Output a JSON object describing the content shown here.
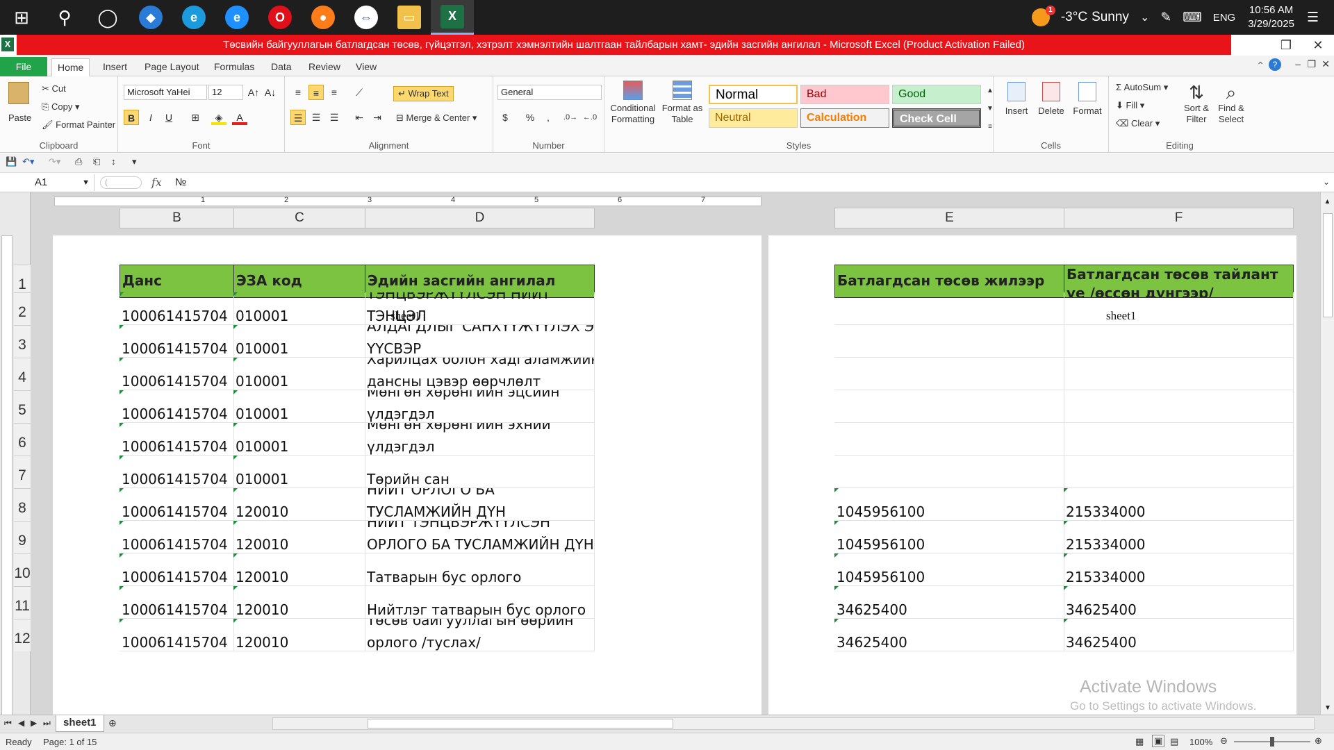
{
  "taskbar": {
    "weather_temp": "-3°C",
    "weather_desc": "Sunny",
    "weather_badge": "1",
    "language": "ENG",
    "time": "10:56 AM",
    "date": "3/29/2025"
  },
  "window": {
    "title": "Төсвийн байгууллагын батлагдсан төсөв, гүйцэтгэл, хэтрэлт хэмнэлтийн шалтгаан тайлбарын хамт- эдийн засгийн ангилал  -  Microsoft Excel (Product Activation Failed)"
  },
  "tabs": [
    "File",
    "Home",
    "Insert",
    "Page Layout",
    "Formulas",
    "Data",
    "Review",
    "View"
  ],
  "ribbon": {
    "clipboard": {
      "paste": "Paste",
      "cut": "Cut",
      "copy": "Copy",
      "format_painter": "Format Painter",
      "label": "Clipboard"
    },
    "font": {
      "name": "Microsoft YaHei",
      "size": "12",
      "label": "Font",
      "bold": "B",
      "italic": "I",
      "underline": "U"
    },
    "alignment": {
      "wrap_text": "Wrap Text",
      "merge_center": "Merge & Center",
      "label": "Alignment"
    },
    "number": {
      "format": "General",
      "currency": "$",
      "percent": "%",
      "comma": ",",
      "label": "Number"
    },
    "styles": {
      "conditional_formatting": "Conditional Formatting",
      "format_as_table": "Format as Table",
      "normal": "Normal",
      "bad": "Bad",
      "good": "Good",
      "neutral": "Neutral",
      "calculation": "Calculation",
      "check_cell": "Check Cell",
      "label": "Styles"
    },
    "cells": {
      "insert": "Insert",
      "delete": "Delete",
      "format": "Format",
      "label": "Cells"
    },
    "editing": {
      "autosum": "AutoSum",
      "fill": "Fill",
      "clear": "Clear",
      "sort_filter": "Sort & Filter",
      "find_select": "Find & Select",
      "label": "Editing"
    }
  },
  "formula_bar": {
    "name_box": "A1",
    "fx": "fx",
    "content": "№"
  },
  "ruler_marks": [
    "1",
    "2",
    "3",
    "4",
    "5",
    "6",
    "7"
  ],
  "sheet": {
    "page_title": "sheet1",
    "columns_left": [
      "B",
      "C",
      "D"
    ],
    "columns_right": [
      "E",
      "F"
    ],
    "row_numbers": [
      "1",
      "2",
      "3",
      "4",
      "5",
      "6",
      "7",
      "8",
      "9",
      "10",
      "11",
      "12"
    ],
    "headers": {
      "B": "Данс",
      "C": "ЭЗА код",
      "D": "Эдийн засгийн ангилал",
      "E": "Батлагдсан төсөв жилээр",
      "F": "Батлагдсан төсөв тайлант үе /өссөн дүнгээр/"
    },
    "rows": [
      {
        "b": "100061415704",
        "c": "010001",
        "d1": "ТЭНЦВЭРЖҮҮЛСЭН НИЙТ",
        "d2": "ТЭНЦЭЛ",
        "e": "",
        "f": ""
      },
      {
        "b": "100061415704",
        "c": "010001",
        "d1": "АЛДАГДЛЫГ САНХҮҮЖҮҮЛЭХ ЭХ",
        "d2": "ҮҮСВЭР",
        "e": "",
        "f": ""
      },
      {
        "b": "100061415704",
        "c": "010001",
        "d1": "Харилцах болон хадгаламжийн",
        "d2": "дансны цэвэр өөрчлөлт",
        "e": "",
        "f": ""
      },
      {
        "b": "100061415704",
        "c": "010001",
        "d1": "Мөнгөн хөрөнгийн эцсийн",
        "d2": "үлдэгдэл",
        "e": "",
        "f": ""
      },
      {
        "b": "100061415704",
        "c": "010001",
        "d1": "Мөнгөн хөрөнгийн эхний",
        "d2": "үлдэгдэл",
        "e": "",
        "f": ""
      },
      {
        "b": "100061415704",
        "c": "010001",
        "d1": "",
        "d2": "Төрийн сан",
        "e": "",
        "f": ""
      },
      {
        "b": "100061415704",
        "c": "120010",
        "d1": "НИЙТ ОРЛОГО БА",
        "d2": "ТУСЛАМЖИЙН ДҮН",
        "e": "1045956100",
        "f": "215334000"
      },
      {
        "b": "100061415704",
        "c": "120010",
        "d1": "НИЙТ ТЭНЦВЭРЖҮҮЛСЭН",
        "d2": "ОРЛОГО БА ТУСЛАМЖИЙН ДҮН",
        "e": "1045956100",
        "f": "215334000"
      },
      {
        "b": "100061415704",
        "c": "120010",
        "d1": "",
        "d2": "Татварын бус орлого",
        "e": "1045956100",
        "f": "215334000"
      },
      {
        "b": "100061415704",
        "c": "120010",
        "d1": "",
        "d2": "Нийтлэг татварын бус орлого",
        "e": "34625400",
        "f": "34625400"
      },
      {
        "b": "100061415704",
        "c": "120010",
        "d1": "Төсөв байгууллагын өөрийн",
        "d2": "орлого /туслах/",
        "e": "34625400",
        "f": "34625400"
      }
    ]
  },
  "sheet_tab": "sheet1",
  "status": {
    "ready": "Ready",
    "page": "Page: 1 of 15",
    "zoom": "100%"
  },
  "watermark": {
    "line1": "Activate Windows",
    "line2": "Go to Settings to activate Windows."
  }
}
